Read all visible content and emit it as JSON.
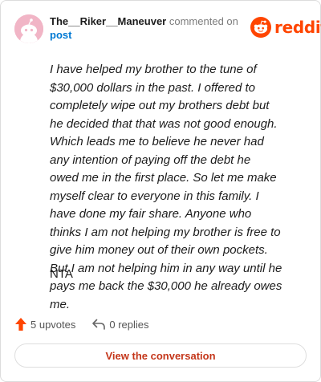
{
  "comment": {
    "author": "The__Riker__Maneuver",
    "action_text": "commented on",
    "target_link": "post",
    "body": "I have helped my brother to the tune of $30,000 dollars in the past. I offered to completely wipe out my brothers debt but he decided that that was not good enough. Which leads me to believe he never had any intention of paying off the debt he owed me in the first place. So let me make myself clear to everyone in this family. I have done my fair share. Anyone who thinks I am not helping my brother is free to give him money out of their own pockets. But I am not helping him in any way until he pays me back the $30,000 he already owes me.",
    "verdict": "NTA"
  },
  "brand": {
    "wordmark": "reddit",
    "color": "#ff4500",
    "icon": "reddit-snoo-icon"
  },
  "actions": {
    "upvotes_label": "5 upvotes",
    "upvote_icon": "upvote-arrow-icon",
    "replies_label": "0 replies",
    "reply_icon": "reply-arrow-icon"
  },
  "cta": {
    "label": "View the conversation"
  },
  "colors": {
    "accent": "#ff4500",
    "link": "#0079d3",
    "cta_text": "#c4361a",
    "avatar_bg": "#f1b5c6"
  }
}
